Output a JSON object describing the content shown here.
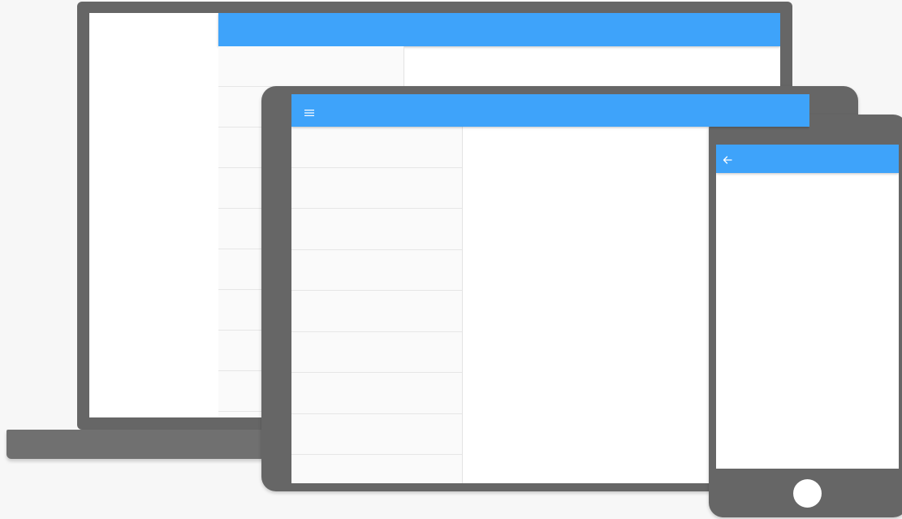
{
  "colors": {
    "appbar": "#3ea3fa",
    "device_body": "#666666",
    "icon": "#ffffff"
  },
  "laptop": {
    "list_item_count": 10
  },
  "tablet": {
    "menu_icon": "menu-icon",
    "list_item_count": 9
  },
  "phone": {
    "back_icon": "arrow-back-icon"
  }
}
